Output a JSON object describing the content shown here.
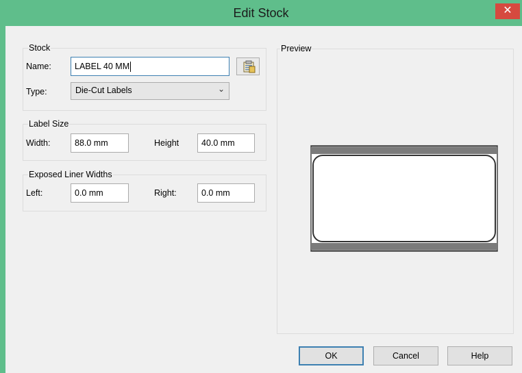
{
  "window": {
    "title": "Edit Stock",
    "close_glyph": "✕",
    "accent_color": "#5fbe8b"
  },
  "stock": {
    "group_label": "Stock",
    "name_label": "Name:",
    "name_value": "LABEL 40 MM",
    "type_label": "Type:",
    "type_value": "Die-Cut Labels",
    "type_arrow": "⌄"
  },
  "label_size": {
    "group_label": "Label Size",
    "width_label": "Width:",
    "width_value": "88.0 mm",
    "height_label": "Height",
    "height_value": "40.0 mm"
  },
  "liner": {
    "group_label": "Exposed Liner Widths",
    "left_label": "Left:",
    "left_value": "0.0 mm",
    "right_label": "Right:",
    "right_value": "0.0 mm"
  },
  "preview": {
    "label": "Preview"
  },
  "buttons": {
    "ok": "OK",
    "cancel": "Cancel",
    "help": "Help"
  }
}
